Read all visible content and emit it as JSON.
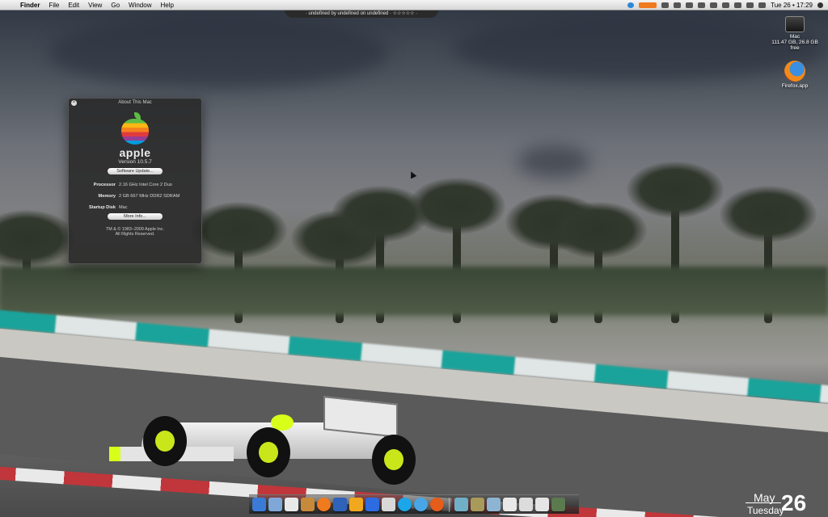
{
  "menubar": {
    "apple_symbol": "",
    "app_name": "Finder",
    "menus": [
      "File",
      "Edit",
      "View",
      "Go",
      "Window",
      "Help"
    ],
    "clock": "Tue 26 • 17:29"
  },
  "now_playing": "· undefined by undefined on undefined · ☆☆☆☆☆ ·",
  "desktop_icons": {
    "hd": {
      "name": "Mac",
      "sub": "111.47 GB, 26.8 GB free"
    },
    "firefox": {
      "name": "Firefox.app"
    }
  },
  "about": {
    "title": "About This Mac",
    "close": "×",
    "wordmark": "apple",
    "version": "Version 10.5.7",
    "software_update": "Software Update...",
    "specs": [
      {
        "label": "Processor",
        "value": "2.16 GHz Intel Core 2 Duo"
      },
      {
        "label": "Memory",
        "value": "2 GB 667 MHz DDR2 SDRAM"
      },
      {
        "label": "Startup Disk",
        "value": "Mac"
      }
    ],
    "more_info": "More Info...",
    "copyright1": "TM & © 1983–2009 Apple Inc.",
    "copyright2": "All Rights Reserved."
  },
  "dock": {
    "apps": [
      "finder-icon",
      "mail-icon",
      "ical-icon",
      "iphoto-icon",
      "firefox-icon",
      "word-icon",
      "pages-icon",
      "todo-icon",
      "pen-icon",
      "skype-icon",
      "itunes-icon",
      "firefox2-icon"
    ],
    "colors": [
      "#3b7bd8",
      "#7fa8d8",
      "#e9e9e9",
      "#c78a3a",
      "#f07a1e",
      "#2f62b9",
      "#f2a81e",
      "#2d6be0",
      "#d8d8d8",
      "#1aa6e8",
      "#49a6e6",
      "#e45d1a"
    ],
    "stack_colors": [
      "#6fb0c8",
      "#a89a5a",
      "#8db4d3",
      "#e8e8e8",
      "#dcdcdc",
      "#e5e5e5",
      "#5b7a4e"
    ]
  },
  "calendar": {
    "month": "May",
    "weekday": "Tuesday",
    "day": "26"
  }
}
